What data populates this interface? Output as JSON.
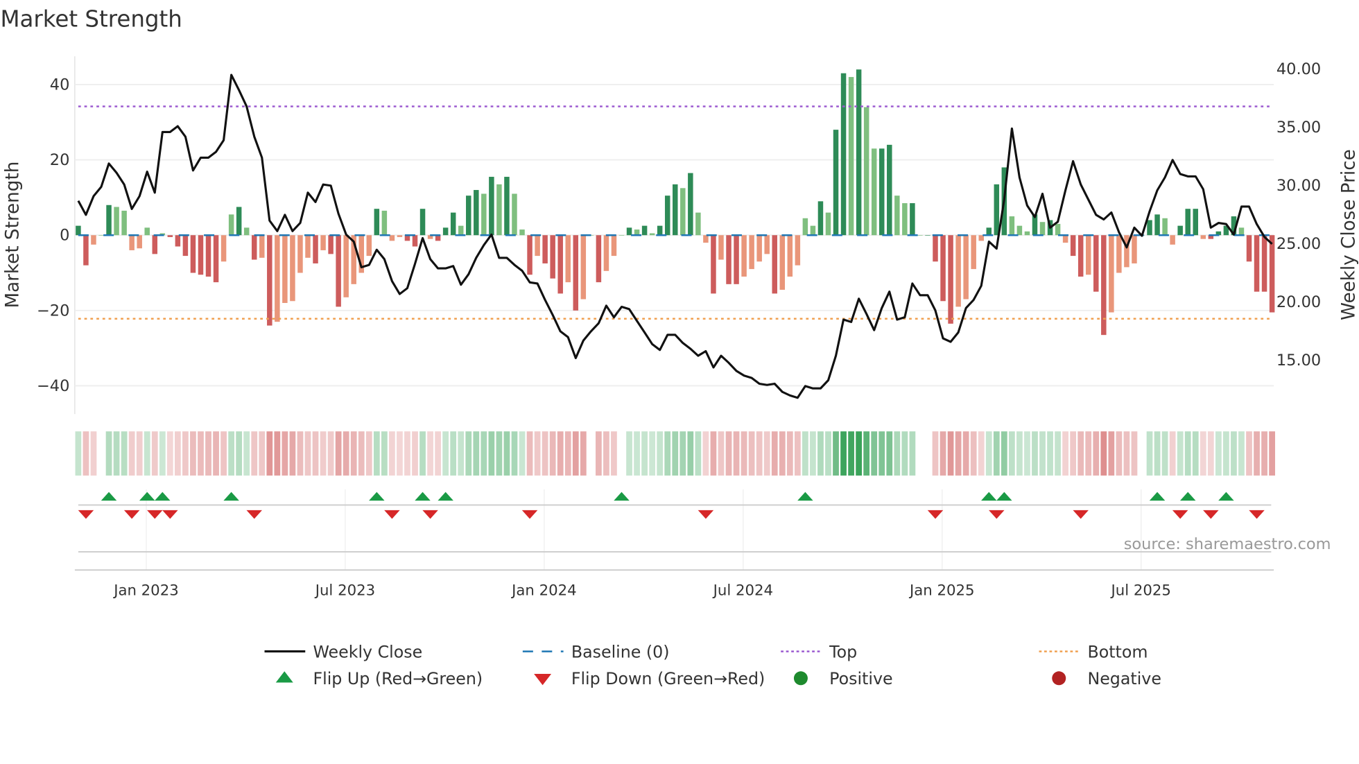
{
  "chart_data": {
    "type": "bar+line",
    "title": "Market Strength",
    "ylabel_left": "Market Strength",
    "ylabel_right": "Weekly Close Price",
    "source": "source: sharemaestro.com",
    "start_week": "2022-10-31",
    "frequency": "weekly",
    "ylim_left": [
      -47.5,
      47.5
    ],
    "ylim_right": [
      10.3,
      41.0
    ],
    "left_ticks": [
      {
        "v": 40,
        "label": "40"
      },
      {
        "v": 20,
        "label": "20"
      },
      {
        "v": 0,
        "label": "0"
      },
      {
        "v": -20,
        "label": "−20"
      },
      {
        "v": -40,
        "label": "−40"
      }
    ],
    "right_ticks": [
      {
        "v": 40,
        "label": "40.00"
      },
      {
        "v": 35,
        "label": "35.00"
      },
      {
        "v": 30,
        "label": "30.00"
      },
      {
        "v": 25,
        "label": "25.00"
      },
      {
        "v": 20,
        "label": "20.00"
      },
      {
        "v": 15,
        "label": "15.00"
      }
    ],
    "x_ticks": [
      {
        "week": 9,
        "label": "Jan 2023"
      },
      {
        "week": 35,
        "label": "Jul 2023"
      },
      {
        "week": 61,
        "label": "Jan 2024"
      },
      {
        "week": 87,
        "label": "Jul 2024"
      },
      {
        "week": 113,
        "label": "Jan 2025"
      },
      {
        "week": 139,
        "label": "Jul 2025"
      }
    ],
    "top_level": 34.2,
    "bottom_level": -22.2,
    "strength": [
      2.5,
      -8,
      -2.5,
      0,
      8,
      7.5,
      6.5,
      -4,
      -3.5,
      2,
      -5,
      0.5,
      -0.5,
      -3,
      -5.5,
      -10,
      -10.5,
      -11,
      -12.5,
      -7,
      5.5,
      7.5,
      2,
      -6.5,
      -6,
      -24,
      -23,
      -18,
      -17.5,
      -10,
      -6,
      -7.5,
      -4,
      -5,
      -19,
      -16.5,
      -13,
      -10,
      -5.5,
      7,
      6.5,
      -1.5,
      -0.5,
      -1.5,
      -3,
      7,
      -1,
      -1.5,
      2,
      6,
      2.5,
      10.5,
      12,
      11,
      15.5,
      13.5,
      15.5,
      11,
      1.5,
      -10.5,
      -5.5,
      -7.5,
      -11.5,
      -15.5,
      -12.5,
      -20,
      -17,
      0,
      -12.5,
      -9.5,
      -5.5,
      0,
      2,
      1.5,
      2.5,
      0.5,
      2.5,
      10.5,
      13.5,
      12.5,
      16.5,
      6,
      -2,
      -15.5,
      -6.5,
      -13,
      -13,
      -11,
      -9,
      -7,
      -5,
      -15.5,
      -14.5,
      -11,
      -8,
      4.5,
      2.5,
      9,
      6,
      28,
      43,
      42,
      44,
      34,
      23,
      23,
      24,
      10.5,
      8.5,
      8.5,
      0,
      0,
      -7,
      -17.5,
      -23.5,
      -19,
      -17,
      -9,
      -1.5,
      2,
      13.5,
      18,
      5,
      2.5,
      1,
      5.5,
      3.5,
      4,
      3,
      -2,
      -5.5,
      -11,
      -10.5,
      -15,
      -26.5,
      -20.5,
      -10,
      -8.5,
      -7.5,
      0,
      4,
      5.5,
      4.5,
      -2.5,
      2.5,
      7,
      7,
      -1,
      -1,
      1,
      2.5,
      5,
      2,
      -7,
      -15,
      -15,
      -20.5
    ],
    "weekly_close": [
      28.6,
      27.4,
      29.0,
      29.8,
      31.8,
      31.0,
      30.0,
      27.9,
      29.0,
      31.1,
      29.3,
      34.5,
      34.5,
      35.0,
      34.1,
      31.2,
      32.3,
      32.3,
      32.8,
      33.8,
      39.4,
      38.1,
      36.7,
      34.1,
      32.3,
      26.9,
      26.0,
      27.4,
      26.0,
      26.7,
      29.3,
      28.5,
      30.0,
      29.9,
      27.5,
      25.7,
      25.1,
      22.9,
      23.1,
      24.4,
      23.6,
      21.7,
      20.6,
      21.1,
      23.2,
      25.4,
      23.6,
      22.8,
      22.8,
      23.0,
      21.4,
      22.3,
      23.7,
      24.8,
      25.7,
      23.7,
      23.7,
      23.1,
      22.6,
      21.6,
      21.5,
      20.1,
      18.8,
      17.4,
      16.9,
      15.1,
      16.6,
      17.4,
      18.1,
      19.6,
      18.6,
      19.5,
      19.3,
      18.3,
      17.3,
      16.3,
      15.8,
      17.1,
      17.1,
      16.4,
      15.9,
      15.3,
      15.7,
      14.3,
      15.3,
      14.7,
      14.0,
      13.6,
      13.4,
      12.9,
      12.8,
      12.9,
      12.2,
      11.9,
      11.7,
      12.7,
      12.5,
      12.5,
      13.2,
      15.3,
      18.4,
      18.2,
      20.2,
      18.9,
      17.5,
      19.4,
      20.8,
      18.4,
      18.6,
      21.5,
      20.5,
      20.5,
      19.2,
      16.8,
      16.5,
      17.3,
      19.4,
      20.1,
      21.3,
      25.1,
      24.5,
      28.7,
      34.8,
      30.6,
      28.2,
      27.2,
      29.2,
      26.3,
      26.8,
      29.5,
      32.0,
      30.0,
      28.7,
      27.4,
      27.0,
      27.6,
      25.9,
      24.6,
      26.3,
      25.6,
      27.7,
      29.5,
      30.6,
      32.1,
      30.9,
      30.7,
      30.7,
      29.6,
      26.3,
      26.7,
      26.6,
      25.7,
      28.1,
      28.1,
      26.6,
      25.5,
      24.9
    ],
    "flip_up_weeks": [
      4,
      9,
      11,
      20,
      39,
      45,
      48,
      71,
      95,
      119,
      121,
      141,
      145,
      150
    ],
    "flip_down_weeks": [
      1,
      7,
      10,
      12,
      23,
      41,
      46,
      59,
      82,
      112,
      120,
      131,
      144,
      148,
      154
    ],
    "legend": {
      "placement": "bottom-center",
      "items": [
        {
          "key": "close",
          "label": "Weekly Close"
        },
        {
          "key": "baseline",
          "label": "Baseline (0)"
        },
        {
          "key": "top",
          "label": "Top"
        },
        {
          "key": "bottom",
          "label": "Bottom"
        },
        {
          "key": "flip_up",
          "label": "Flip Up (Red→Green)"
        },
        {
          "key": "flip_down",
          "label": "Flip Down (Green→Red)"
        },
        {
          "key": "positive",
          "label": "Positive"
        },
        {
          "key": "negative",
          "label": "Negative"
        }
      ]
    },
    "colors": {
      "pos_dark": "#2e8b57",
      "pos_light": "#7fbf7f",
      "neg_dark": "#cd5c5c",
      "neg_light": "#e9967a",
      "line": "#111111",
      "baseline": "#1f77b4",
      "top": "#9b59d0",
      "bottom": "#f0a050",
      "flip_up": "#1a9a45",
      "flip_down": "#d62728",
      "positive": "#1e8a2e",
      "negative": "#b22222"
    }
  }
}
